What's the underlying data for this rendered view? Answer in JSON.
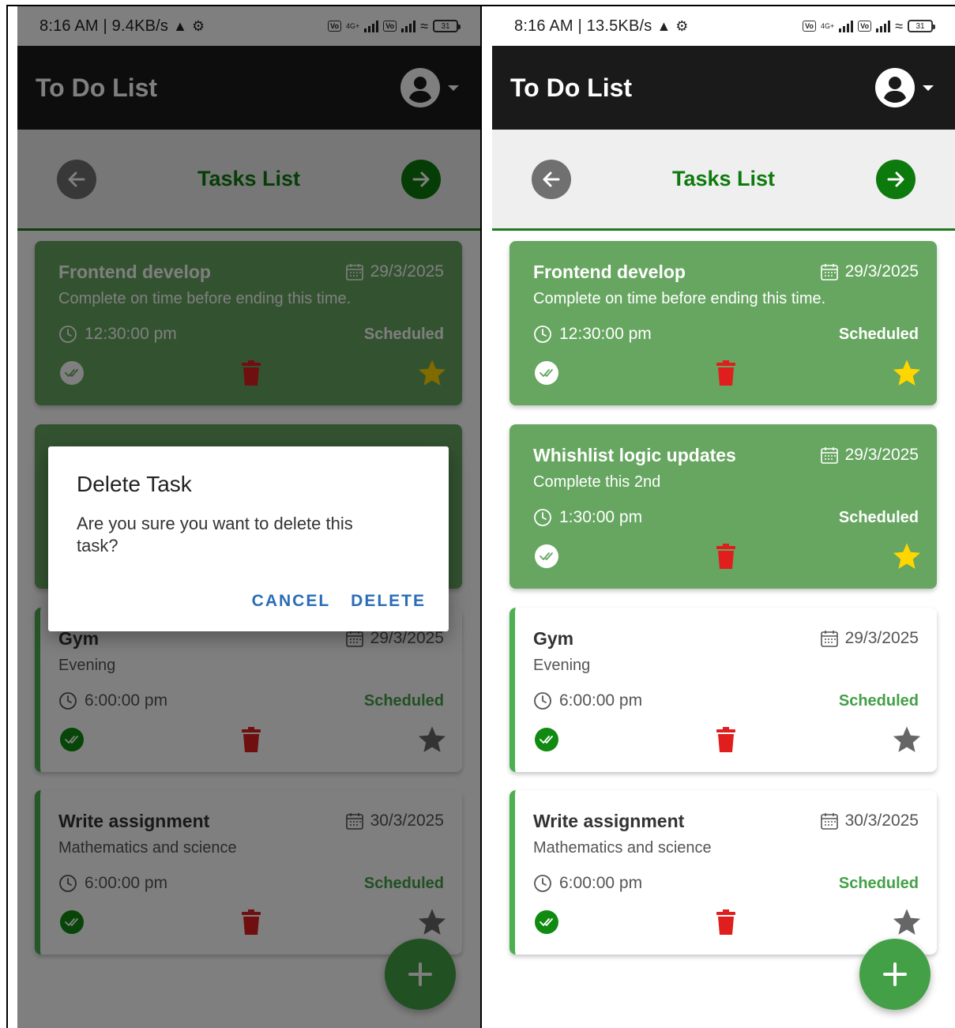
{
  "screens": {
    "left": {
      "status_time": "8:16 AM | 9.4KB/s",
      "appbar": {
        "title": "To Do List"
      },
      "header": {
        "title": "Tasks List"
      },
      "tasks": [
        {
          "title": "Frontend develop",
          "date": "29/3/2025",
          "description": "Complete on time before ending this time.",
          "time": "12:30:00 pm",
          "status": "Scheduled",
          "favorite": true
        },
        {
          "title": "Whishlist logic updates",
          "date": "29/3/2025",
          "description": "Complete this 2nd",
          "time": "1:30:00 pm",
          "status": "Scheduled",
          "favorite": true
        },
        {
          "title": "Gym",
          "date": "29/3/2025",
          "description": "Evening",
          "time": "6:00:00 pm",
          "status": "Scheduled",
          "favorite": false
        },
        {
          "title": "Write assignment",
          "date": "30/3/2025",
          "description": "Mathematics and science",
          "time": "6:00:00 pm",
          "status": "Scheduled",
          "favorite": false
        }
      ],
      "dialog": {
        "title": "Delete Task",
        "message": "Are you sure you want to delete this task?",
        "cancel_label": "CANCEL",
        "delete_label": "DELETE"
      }
    },
    "right": {
      "status_time": "8:16 AM | 13.5KB/s",
      "appbar": {
        "title": "To Do List"
      },
      "header": {
        "title": "Tasks List"
      },
      "tasks": [
        {
          "title": "Frontend develop",
          "date": "29/3/2025",
          "description": "Complete on time before ending this time.",
          "time": "12:30:00 pm",
          "status": "Scheduled",
          "favorite": true
        },
        {
          "title": "Whishlist logic updates",
          "date": "29/3/2025",
          "description": "Complete this 2nd",
          "time": "1:30:00 pm",
          "status": "Scheduled",
          "favorite": true
        },
        {
          "title": "Gym",
          "date": "29/3/2025",
          "description": "Evening",
          "time": "6:00:00 pm",
          "status": "Scheduled",
          "favorite": false
        },
        {
          "title": "Write assignment",
          "date": "30/3/2025",
          "description": "Mathematics and science",
          "time": "6:00:00 pm",
          "status": "Scheduled",
          "favorite": false
        }
      ]
    }
  },
  "status_icons": {
    "battery_level": "31",
    "network_label": "4G+"
  },
  "icons": {
    "account": "account-circle-icon",
    "menu_caret": "caret-down-icon",
    "previous": "arrow-left-icon",
    "next": "arrow-right-icon",
    "date": "calendar-icon",
    "time": "clock-icon",
    "complete": "double-check-icon",
    "delete": "trash-icon",
    "favorite": "star-icon",
    "add": "plus-icon"
  },
  "colors": {
    "appbar_bg": "#1a1a1a",
    "accent_green": "#0d7a0d",
    "favorite_card_bg": "#66a660",
    "status_green": "#43a047",
    "delete_red": "#e01e1e",
    "star_yellow": "#ffd600",
    "star_grey": "#666666",
    "dialog_button_blue": "#2a6db5"
  }
}
